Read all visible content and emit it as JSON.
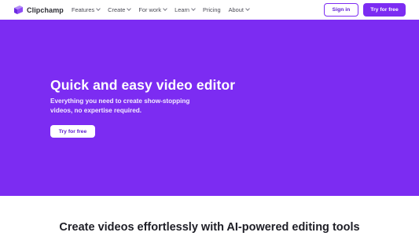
{
  "brand": {
    "name": "Clipchamp"
  },
  "nav": {
    "items": [
      {
        "label": "Features",
        "has_dropdown": true
      },
      {
        "label": "Create",
        "has_dropdown": true
      },
      {
        "label": "For work",
        "has_dropdown": true
      },
      {
        "label": "Learn",
        "has_dropdown": true
      },
      {
        "label": "Pricing",
        "has_dropdown": false
      },
      {
        "label": "About",
        "has_dropdown": true
      }
    ],
    "sign_in_label": "Sign in",
    "try_label": "Try for free"
  },
  "hero": {
    "title": "Quick and easy video editor",
    "subtitle": "Everything you need to create show-stopping videos, no expertise required.",
    "cta_label": "Try for free"
  },
  "section": {
    "title": "Create videos effortlessly with AI-powered editing tools"
  },
  "colors": {
    "brand_purple": "#7c2cf2",
    "text_dark": "#1e1e26",
    "nav_text": "#4a4a55"
  }
}
